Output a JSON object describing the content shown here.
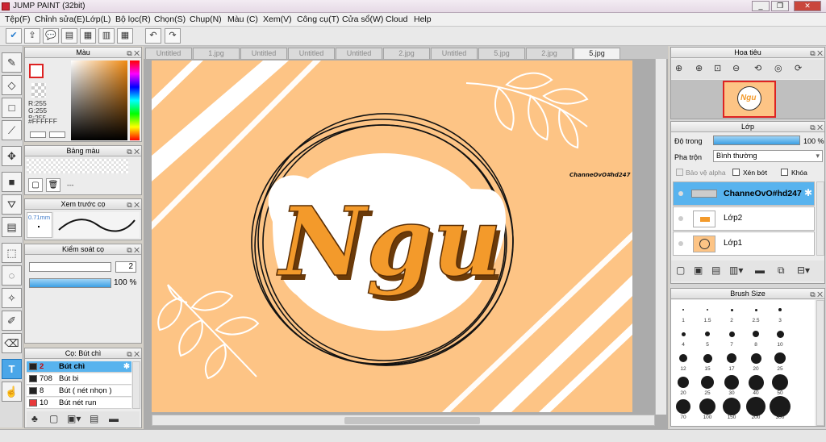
{
  "window": {
    "title": "JUMP PAINT (32bit)"
  },
  "menu": [
    "Tệp(F)",
    "Chỉnh sửa(E)",
    "Lớp(L)",
    "Bộ lọc(R)",
    "Chọn(S)",
    "Chụp(N)",
    "Màu (C)",
    "Xem(V)",
    "Công cụ(T)",
    "Cửa sổ(W)",
    "Cloud",
    "Help"
  ],
  "tabs": [
    "Untitled",
    "1.jpg",
    "Untitled",
    "Untitled",
    "Untitled",
    "2.jpg",
    "Untitled",
    "5.jpg",
    "2.jpg",
    "5.jpg"
  ],
  "active_tab": 9,
  "color_panel": {
    "title": "Màu",
    "r": "R:255",
    "g": "G:255",
    "b": "B:255",
    "hex": "#FFFFFF"
  },
  "palette_panel": {
    "title": "Bảng màu",
    "dash": "---"
  },
  "preview_panel": {
    "title": "Xem trước cọ",
    "size": "0.71mm"
  },
  "brush_control": {
    "title": "Kiểm soát cọ",
    "size_value": "2",
    "opacity_value": "100 %"
  },
  "brush_list": {
    "title": "Cọ: Bút chì",
    "items": [
      {
        "num": "2",
        "name": "Bút chì",
        "color": "#222222",
        "selected": true
      },
      {
        "num": "708",
        "name": "Bút bi",
        "color": "#222222",
        "selected": false
      },
      {
        "num": "8",
        "name": "Bút ( nét nhọn )",
        "color": "#222222",
        "selected": false
      },
      {
        "num": "10",
        "name": "Bút nét run",
        "color": "#e8383a",
        "selected": false
      }
    ]
  },
  "navigator": {
    "title": "Hoa tiêu"
  },
  "layers": {
    "title": "Lớp",
    "opacity_label": "Độ trong",
    "opacity_value": "100 %",
    "blend_label": "Pha trộn",
    "blend_value": "Bình thường",
    "protect_alpha": "Bảo vệ alpha",
    "clip": "Xén bớt",
    "lock": "Khóa",
    "items": [
      {
        "name": "ChanneOvO#hd247",
        "selected": true
      },
      {
        "name": "Lớp2",
        "selected": false
      },
      {
        "name": "Lớp1",
        "selected": false
      }
    ]
  },
  "brush_size": {
    "title": "Brush Size",
    "rows": [
      [
        "1",
        "1.5",
        "2",
        "2.5",
        "3"
      ],
      [
        "4",
        "5",
        "7",
        "8",
        "10"
      ],
      [
        "12",
        "15",
        "17",
        "20",
        "25"
      ],
      [
        "20",
        "25",
        "30",
        "40",
        "50"
      ],
      [
        "70",
        "100",
        "150",
        "200",
        "300"
      ]
    ]
  },
  "artwork": {
    "word": "Ngu",
    "watermark": "ChanneOvO#hd247"
  },
  "colors": {
    "accent": "#58b3ee",
    "canvas_bg": "#fdc485",
    "orange": "#f39a2b"
  }
}
